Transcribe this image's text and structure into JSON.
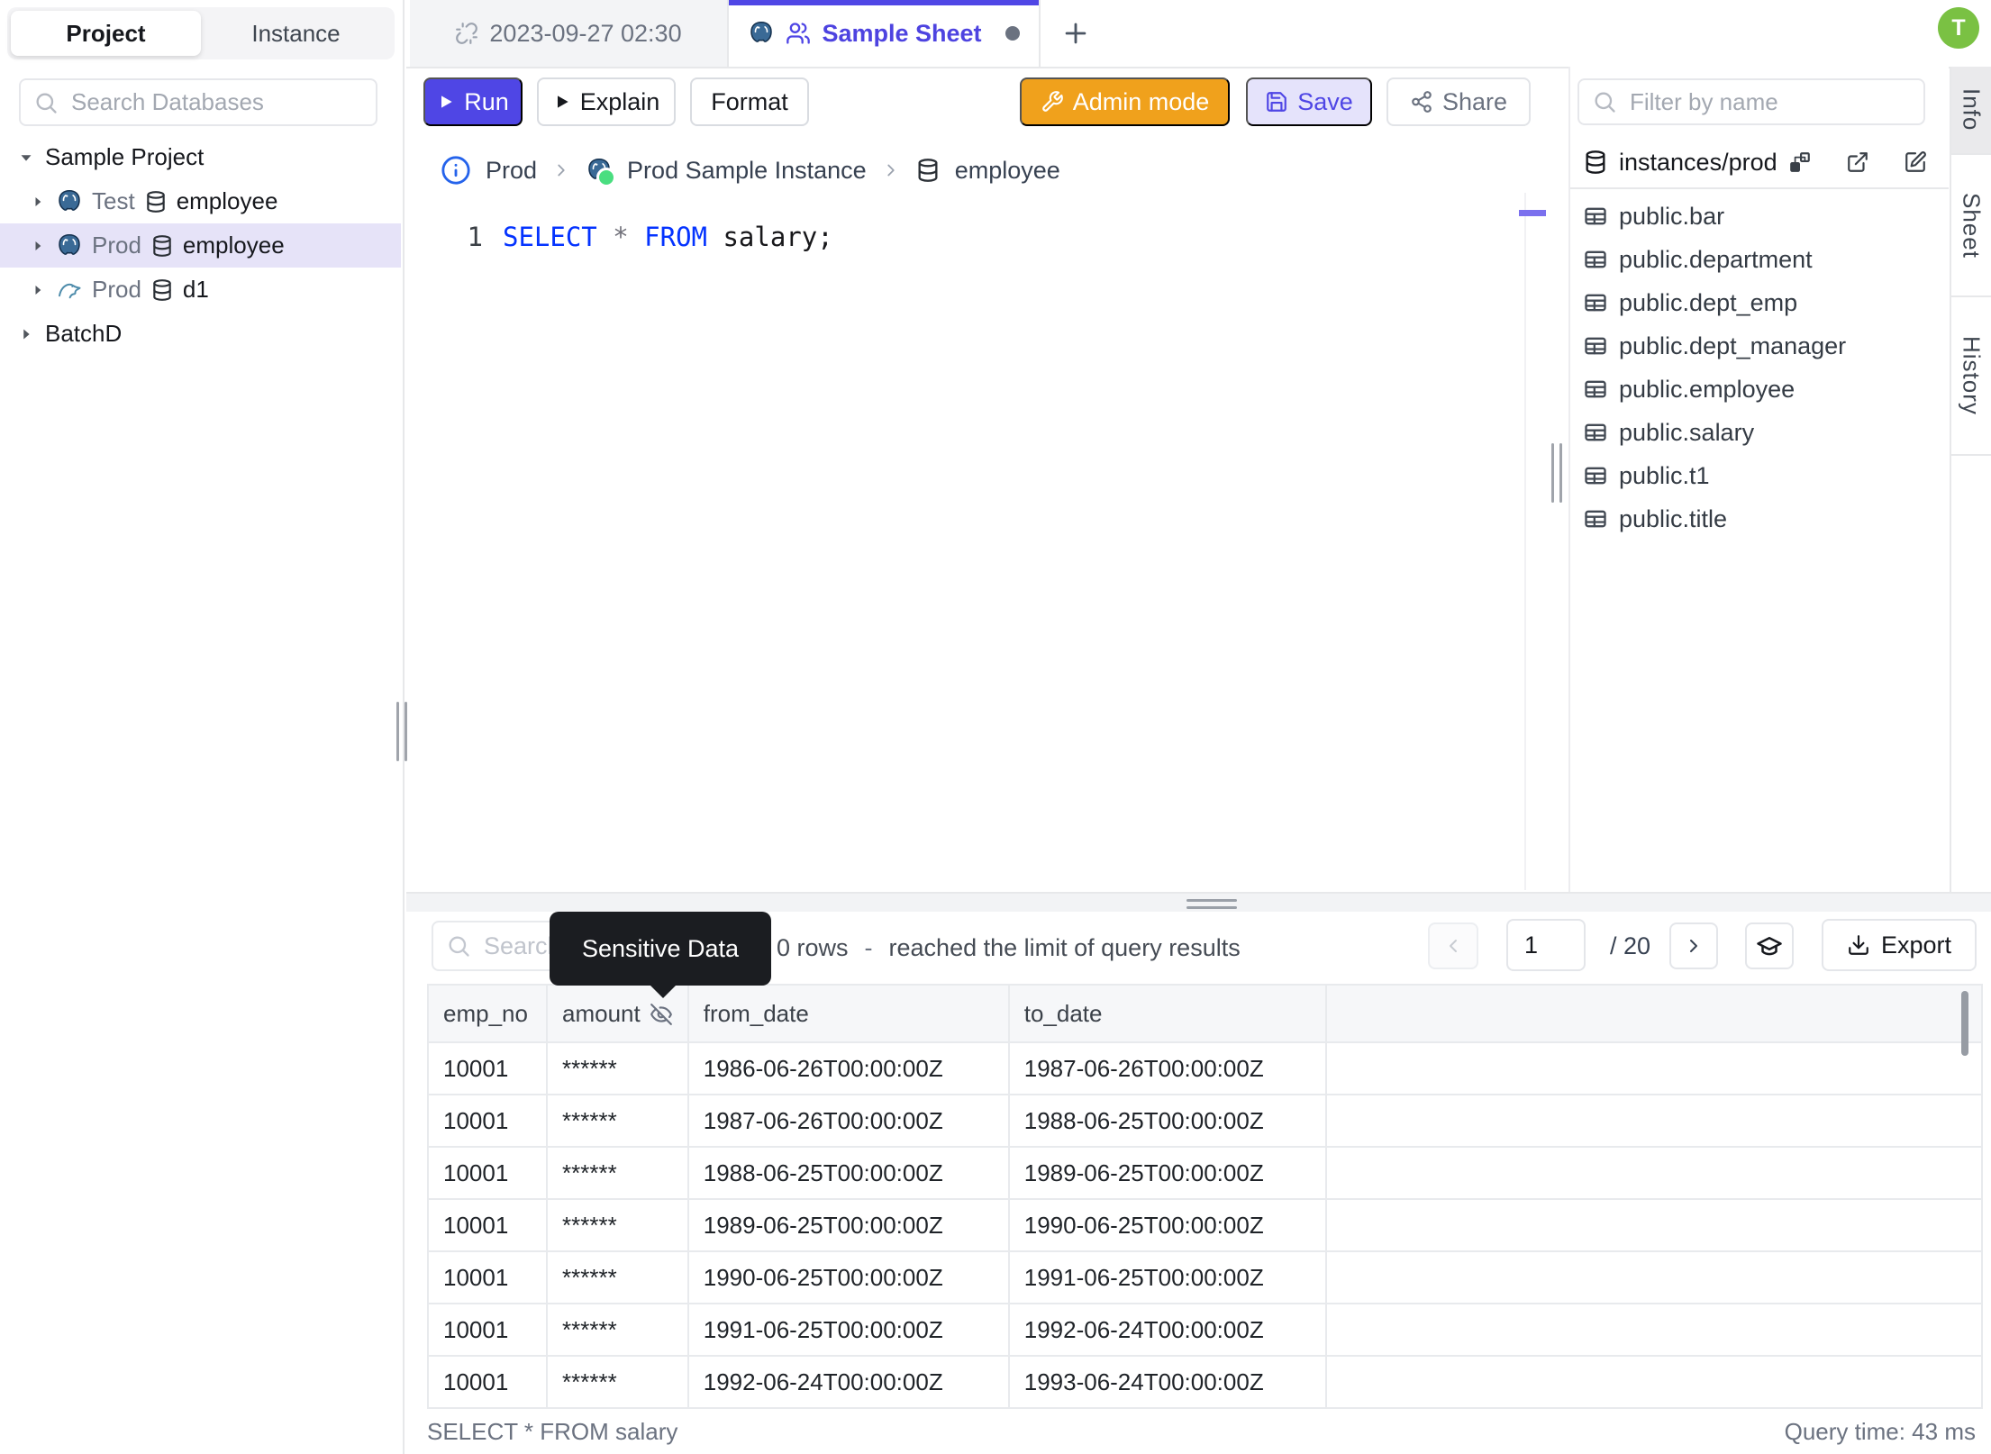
{
  "header": {
    "avatar_initial": "T",
    "tabs": [
      {
        "label": "2023-09-27 02:30",
        "active": false,
        "dirty": false
      },
      {
        "label": "Sample Sheet",
        "active": true,
        "dirty": true
      }
    ],
    "new_tab_button": "+"
  },
  "left_sidebar": {
    "tabs": [
      {
        "label": "Project",
        "active": true
      },
      {
        "label": "Instance",
        "active": false
      }
    ],
    "search_placeholder": "Search Databases",
    "tree": [
      {
        "type": "project",
        "label": "Sample Project",
        "expanded": true
      },
      {
        "type": "database",
        "engine": "postgresql",
        "environment": "Test",
        "name": "employee",
        "selected": false
      },
      {
        "type": "database",
        "engine": "postgresql",
        "environment": "Prod",
        "name": "employee",
        "selected": true
      },
      {
        "type": "database",
        "engine": "mysql",
        "environment": "Prod",
        "name": "d1",
        "selected": false
      },
      {
        "type": "project",
        "label": "BatchD",
        "expanded": false
      }
    ]
  },
  "toolbar": {
    "run_label": "Run",
    "explain_label": "Explain",
    "format_label": "Format",
    "admin_mode_label": "Admin mode",
    "save_label": "Save",
    "share_label": "Share"
  },
  "breadcrumb": {
    "environment": "Prod",
    "instance": "Prod Sample Instance",
    "database": "employee"
  },
  "editor": {
    "line_number": "1",
    "tokens": [
      {
        "text": "SELECT",
        "type": "keyword"
      },
      {
        "text": " ",
        "type": "plain"
      },
      {
        "text": "*",
        "type": "operator"
      },
      {
        "text": " ",
        "type": "plain"
      },
      {
        "text": "FROM",
        "type": "keyword"
      },
      {
        "text": " salary;",
        "type": "plain"
      }
    ]
  },
  "schema_panel": {
    "filter_placeholder": "Filter by name",
    "header_label": "instances/prod",
    "tables": [
      "public.bar",
      "public.department",
      "public.dept_emp",
      "public.dept_manager",
      "public.employee",
      "public.salary",
      "public.t1",
      "public.title"
    ]
  },
  "right_tabs": [
    {
      "label": "Info",
      "active": true
    },
    {
      "label": "Sheet",
      "active": false
    },
    {
      "label": "History",
      "active": false
    }
  ],
  "results": {
    "search_placeholder": "Search",
    "tooltip": "Sensitive Data",
    "rows_count_text": "0 rows",
    "separator": "-",
    "limit_text": "reached the limit of query results",
    "page_value": "1",
    "page_total": "/ 20",
    "export_label": "Export",
    "columns": [
      "emp_no",
      "amount",
      "from_date",
      "to_date"
    ],
    "masked_column_index": 1,
    "rows": [
      [
        "10001",
        "******",
        "1986-06-26T00:00:00Z",
        "1987-06-26T00:00:00Z"
      ],
      [
        "10001",
        "******",
        "1987-06-26T00:00:00Z",
        "1988-06-25T00:00:00Z"
      ],
      [
        "10001",
        "******",
        "1988-06-25T00:00:00Z",
        "1989-06-25T00:00:00Z"
      ],
      [
        "10001",
        "******",
        "1989-06-25T00:00:00Z",
        "1990-06-25T00:00:00Z"
      ],
      [
        "10001",
        "******",
        "1990-06-25T00:00:00Z",
        "1991-06-25T00:00:00Z"
      ],
      [
        "10001",
        "******",
        "1991-06-25T00:00:00Z",
        "1992-06-24T00:00:00Z"
      ],
      [
        "10001",
        "******",
        "1992-06-24T00:00:00Z",
        "1993-06-24T00:00:00Z"
      ]
    ],
    "footer_query": "SELECT * FROM salary",
    "footer_time": "Query time: 43 ms"
  },
  "colors": {
    "accent_indigo": "#4f46e5",
    "admin_orange": "#f0a11c",
    "avatar_green": "#7ac143",
    "keyword_blue": "#0433ff",
    "status_green": "#4ade80",
    "selected_row": "#e6e3f8"
  }
}
